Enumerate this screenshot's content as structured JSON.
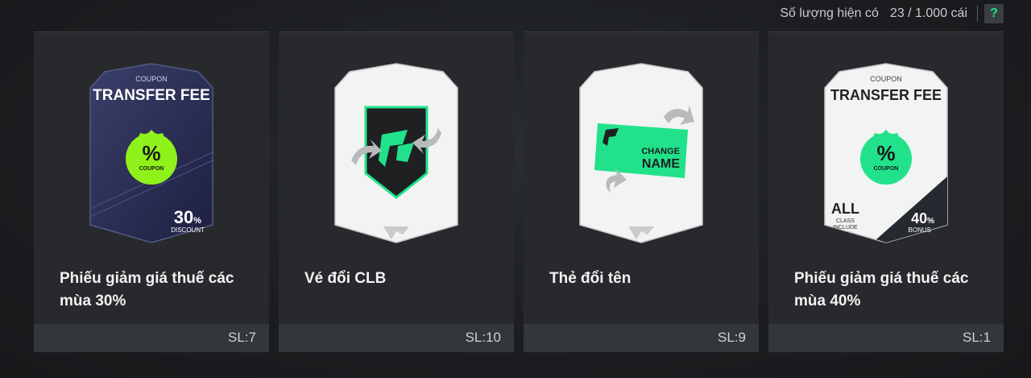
{
  "header": {
    "quantity_label": "Số lượng hiện có",
    "quantity_value": "23 / 1.000 cái",
    "help_label": "?"
  },
  "cards": [
    {
      "title": "Phiếu giảm giá thuế các mùa 30%",
      "qty": "SL:7",
      "coupon_small": "COUPON",
      "coupon_big": "TRANSFER FEE",
      "badge_symbol": "%",
      "badge_text": "COUPON",
      "pct": "30",
      "pct_unit": "%",
      "pct_sub": "DISCOUNT",
      "icon": "coupon-card-icon"
    },
    {
      "title": "Vé đổi CLB",
      "qty": "SL:10",
      "icon": "club-change-ticket-icon"
    },
    {
      "title": "Thẻ đổi tên",
      "qty": "SL:9",
      "change_text_1": "CHANGE",
      "change_text_2": "NAME",
      "icon": "name-change-card-icon"
    },
    {
      "title": "Phiếu giảm giá thuế các mùa 40%",
      "qty": "SL:1",
      "coupon_small": "COUPON",
      "coupon_big": "TRANSFER FEE",
      "badge_symbol": "%",
      "badge_text": "COUPON",
      "all_text": "ALL",
      "class_text_1": "CLASS",
      "class_text_2": "INCLUDE",
      "pct": "40",
      "pct_unit": "%",
      "pct_sub": "BONUS",
      "icon": "coupon-card-icon"
    }
  ],
  "colors": {
    "accent": "#21e28a",
    "badge_green": "#8ff21a",
    "card_bg": "#27292c",
    "footer_bg": "#34373a"
  }
}
